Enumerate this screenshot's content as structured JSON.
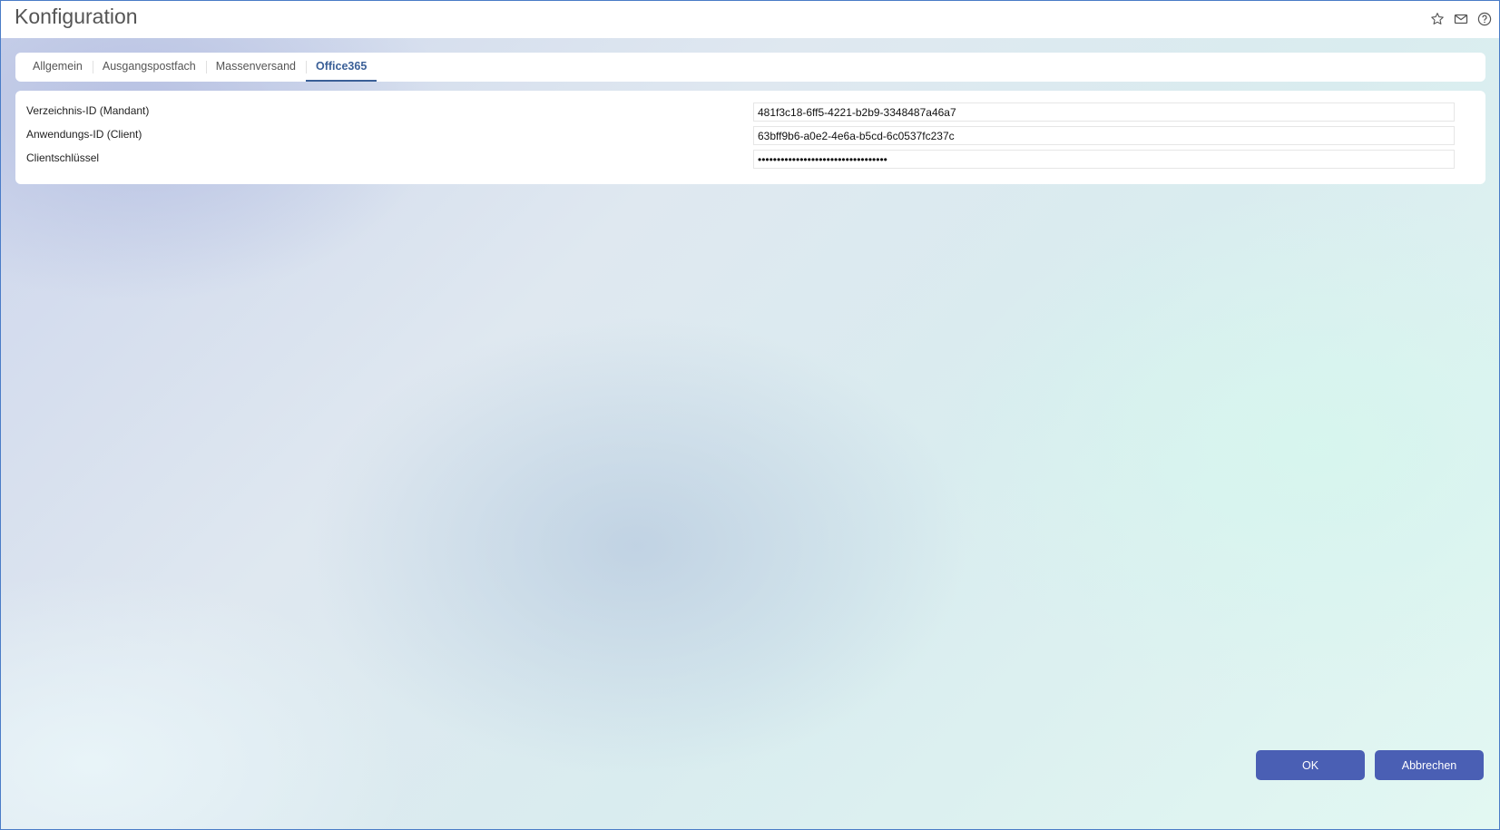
{
  "window": {
    "title": "Konfiguration",
    "icons": [
      "star-icon",
      "mail-icon",
      "help-icon"
    ]
  },
  "tabs": [
    {
      "label": "Allgemein",
      "active": false
    },
    {
      "label": "Ausgangspostfach",
      "active": false
    },
    {
      "label": "Massenversand",
      "active": false
    },
    {
      "label": "Office365",
      "active": true
    }
  ],
  "form": {
    "fields": [
      {
        "label": "Verzeichnis-ID (Mandant)",
        "value": "481f3c18-6ff5-4221-b2b9-3348487a46a7",
        "type": "text"
      },
      {
        "label": "Anwendungs-ID (Client)",
        "value": "63bff9b6-a0e2-4e6a-b5cd-6c0537fc237c",
        "type": "text"
      },
      {
        "label": "Clientschlüssel",
        "value": "••••••••••••••••••••••••••••••••••",
        "type": "password"
      }
    ]
  },
  "footer": {
    "ok_label": "OK",
    "cancel_label": "Abbrechen"
  },
  "colors": {
    "accent": "#3a5f97",
    "button": "#4a5fb4",
    "window_border": "#4a7cc7"
  }
}
